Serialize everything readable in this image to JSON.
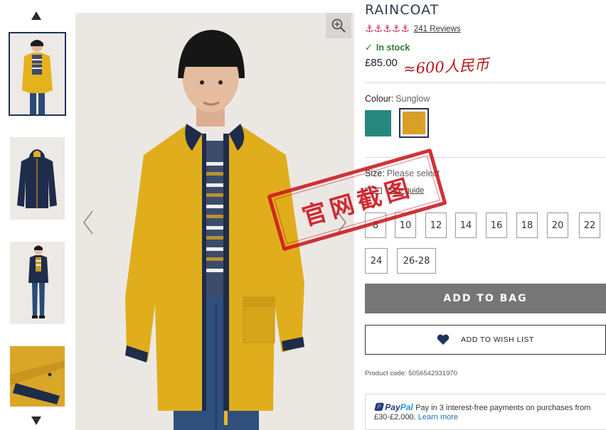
{
  "product": {
    "title": "RAINCOAT",
    "rating_icons": "⚓⚓⚓⚓⚓",
    "reviews": "241 Reviews",
    "stock": "In stock",
    "price": "£85.00",
    "annotation": "≈600人民币",
    "colour_label": "Colour:",
    "colour_value": "Sunglow",
    "colours": [
      "#27887e",
      "#d9a028"
    ],
    "size_label": "Size:",
    "size_value": "Please select",
    "size_guide": "Size guide",
    "sizes": [
      "8",
      "10",
      "12",
      "14",
      "16",
      "18",
      "20",
      "22",
      "24",
      "26-28"
    ],
    "add_to_bag": "ADD TO BAG",
    "add_to_wishlist": "ADD TO WISH LIST",
    "product_code": "Product code: 5056542931970",
    "paypal": {
      "brand_pay": "Pay",
      "brand_pal": "Pal",
      "line1": "Pay in 3 interest-free payments on purchases from",
      "line2": "£30-£2,000.",
      "learn_more": "Learn more"
    }
  },
  "stamp_text": "官网截图",
  "icons": {
    "thumb_up": "triangle-up-icon",
    "thumb_down": "triangle-down-icon",
    "zoom": "zoom-in-icon",
    "prev": "chevron-left-icon",
    "next": "chevron-right-icon",
    "check": "check-icon",
    "heart": "heart-icon"
  },
  "colors": {
    "accent_navy": "#1f3256",
    "stock_green": "#2f7a36",
    "rating_pink": "#c0264b",
    "button_grey": "#767676",
    "stamp_red": "#cd141e",
    "jacket_yellow": "#e0ae1c"
  }
}
